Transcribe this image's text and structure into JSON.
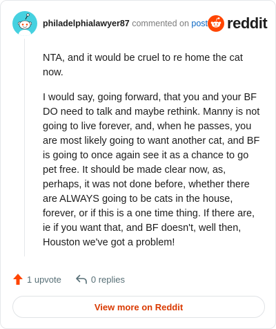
{
  "comment": {
    "author": "philadelphialawyer87",
    "action_text": "commented on",
    "post_link": "post",
    "paragraphs": [
      "NTA, and it would be cruel to re home the cat now.",
      "I would say, going forward, that you and your BF DO need to talk and maybe rethink. Manny is not going to live forever, and, when he passes, you are most likely going to want another cat, and BF is going to once again see it as a chance to go pet free. It should be made clear now, as, perhaps, it was not done before, whether there are ALWAYS going to be cats in the house, forever, or if this is a one time thing. If there are, ie if you want that, and BF doesn't, well then, Houston we've got a problem!"
    ],
    "upvotes_label": "1 upvote",
    "replies_label": "0 replies"
  },
  "brand": {
    "wordmark": "reddit",
    "accent_color": "#ff4500",
    "upvote_color": "#ff4500",
    "avatar_bg": "#46d1e0"
  },
  "footer": {
    "view_more_label": "View more on Reddit",
    "view_more_color": "#d93900"
  },
  "icons": {
    "avatar": "snoo-avatar-icon",
    "logo": "reddit-logo-icon",
    "upvote": "upvote-arrow-icon",
    "reply": "reply-arrow-icon"
  }
}
